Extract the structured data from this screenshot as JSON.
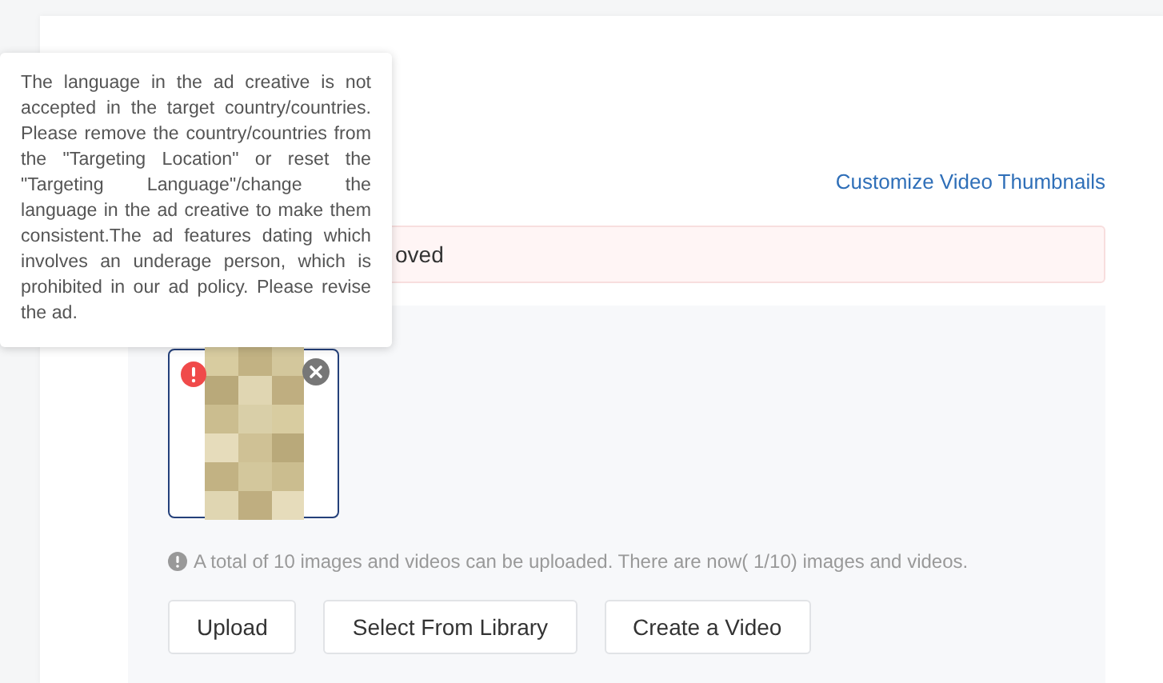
{
  "header": {
    "link": "Customize Video Thumbnails"
  },
  "alert": {
    "text": "oved"
  },
  "tooltip": {
    "text": "The language in the ad creative is not accepted in the target country/countries. Please remove the country/countries from the \"Targeting Location\" or reset the \"Targeting Language\"/change the language in the ad creative to make them consistent.The ad features dating which involves an underage person, which is prohibited in our ad policy. Please revise the ad."
  },
  "media": [
    {
      "kind": "picture",
      "error": true
    }
  ],
  "hint": "A total of 10 images and videos can be uploaded. There are now( 1/10) images and videos.",
  "buttons": [
    "Upload",
    "Select From Library",
    "Create a Video"
  ]
}
